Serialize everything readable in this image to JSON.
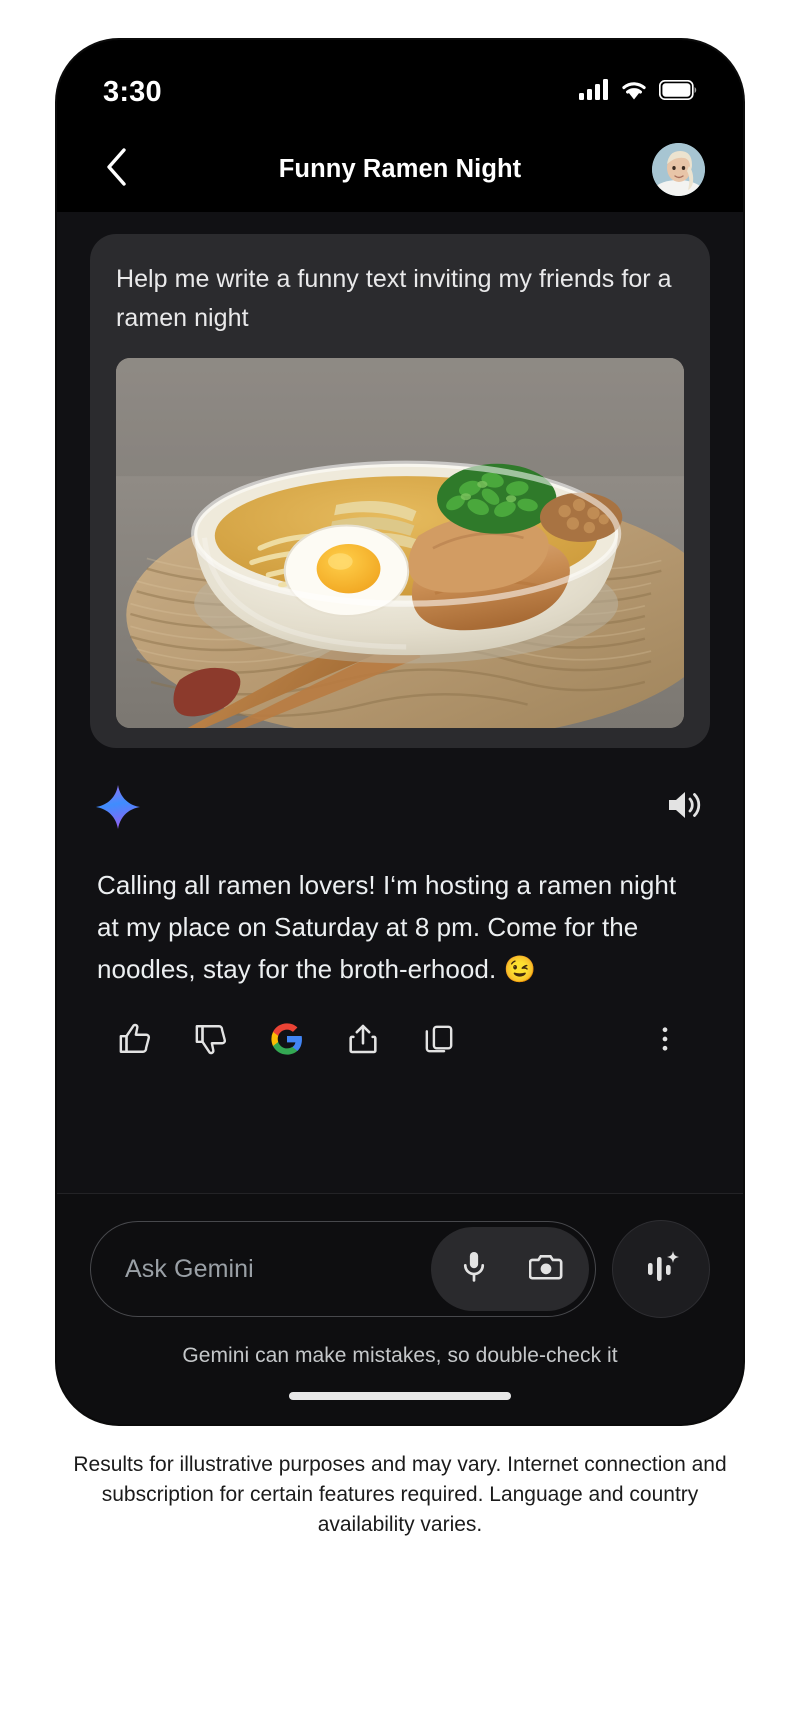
{
  "status_bar": {
    "time": "3:30",
    "cellular_icon": "cellular-signal-icon",
    "wifi_icon": "wifi-icon",
    "battery_icon": "battery-full-icon"
  },
  "header": {
    "back_icon": "chevron-left-icon",
    "title": "Funny Ramen Night",
    "avatar_alt": "user-avatar"
  },
  "conversation": {
    "user_message": {
      "text": "Help me write a funny text inviting my friends for a ramen night",
      "attachment_alt": "ramen-bowl-photo"
    },
    "response": {
      "gemini_icon": "gemini-sparkle-icon",
      "speaker_icon": "speaker-volume-icon",
      "text": "Calling all ramen lovers! I‘m hosting a ramen night at my place on Saturday at 8 pm.  Come for the noodles, stay for the broth-erhood. 😉",
      "actions": [
        {
          "name": "thumb-up-icon",
          "label": "Good response"
        },
        {
          "name": "thumb-down-icon",
          "label": "Bad response"
        },
        {
          "name": "google-g-icon",
          "label": "Google it"
        },
        {
          "name": "share-icon",
          "label": "Share"
        },
        {
          "name": "copy-icon",
          "label": "Copy"
        },
        {
          "name": "more-vertical-icon",
          "label": "More"
        }
      ]
    }
  },
  "composer": {
    "placeholder": "Ask Gemini",
    "mic_icon": "microphone-icon",
    "camera_icon": "camera-icon",
    "live_icon": "gemini-live-waveform-icon"
  },
  "disclaimer": "Gemini can make mistakes, so double-check it",
  "caption": "Results for illustrative purposes and may vary. Internet connection and subscription for certain features required. Language and country availability varies.",
  "colors": {
    "page_background": "#ffffff",
    "phone_frame": "#000000",
    "screen_background": "#111114",
    "bubble_background": "#2b2b2e",
    "text_primary": "#eceff1",
    "text_secondary": "#9aa0a6",
    "gemini_blue": "#3b6cf6",
    "gemini_purple": "#8a5cf0",
    "google_blue": "#4285F4",
    "google_red": "#EA4335",
    "google_yellow": "#FBBC05",
    "google_green": "#34A853"
  }
}
